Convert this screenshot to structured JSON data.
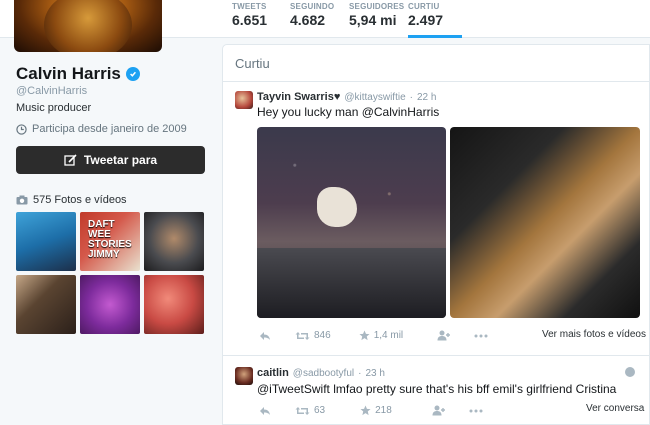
{
  "header": {
    "stats": [
      {
        "label": "TWEETS",
        "value": "6.651"
      },
      {
        "label": "SEGUINDO",
        "value": "4.682"
      },
      {
        "label": "SEGUIDORES",
        "value": "5,94 mi"
      },
      {
        "label": "CURTIU",
        "value": "2.497"
      }
    ],
    "active_tab": "CURTIU",
    "accent_color": "#1da1f2"
  },
  "profile": {
    "name": "Calvin Harris",
    "handle": "@CalvinHarris",
    "bio": "Music producer",
    "joined": "Participa desde janeiro de 2009",
    "tweet_to_label": "Tweetar para",
    "photos_label": "575 Fotos e vídeos",
    "thumb_2_text": "DAFT WEE STORIES JIMMY"
  },
  "timeline": {
    "title": "Curtiu",
    "tweets": [
      {
        "name": "Tayvin Swarris♥",
        "handle": "@kittayswiftie",
        "time": "22 h",
        "text": "Hey you lucky man @CalvinHarris",
        "retweets": "846",
        "likes": "1,4 mil",
        "more_link": "Ver mais fotos e vídeos"
      },
      {
        "name": "caitlin",
        "handle": "@sadbootyful",
        "time": "23 h",
        "text": "@iTweetSwift lmfao pretty sure that's his bff emil's girlfriend Cristina",
        "retweets": "63",
        "likes": "218",
        "more_link": "Ver conversa"
      }
    ]
  }
}
